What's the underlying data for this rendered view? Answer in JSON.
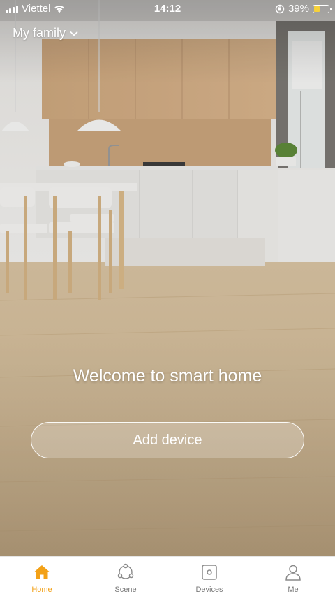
{
  "status_bar": {
    "carrier": "Viettel",
    "time": "14:12",
    "battery_percent": "39%",
    "battery_level": 0.39,
    "icons": [
      "signal-icon",
      "wifi-icon",
      "orientation-lock-icon",
      "battery-charging-icon"
    ]
  },
  "header": {
    "family_label": "My family",
    "dropdown_icon": "chevron-down-icon"
  },
  "main": {
    "welcome_text": "Welcome to smart home",
    "add_device_label": "Add device"
  },
  "tabs": [
    {
      "label": "Home",
      "icon": "home-icon",
      "active": true
    },
    {
      "label": "Scene",
      "icon": "scene-icon",
      "active": false
    },
    {
      "label": "Devices",
      "icon": "devices-icon",
      "active": false
    },
    {
      "label": "Me",
      "icon": "person-icon",
      "active": false
    }
  ],
  "colors": {
    "accent": "#f3a117",
    "tab_inactive": "#7a7a7a"
  }
}
